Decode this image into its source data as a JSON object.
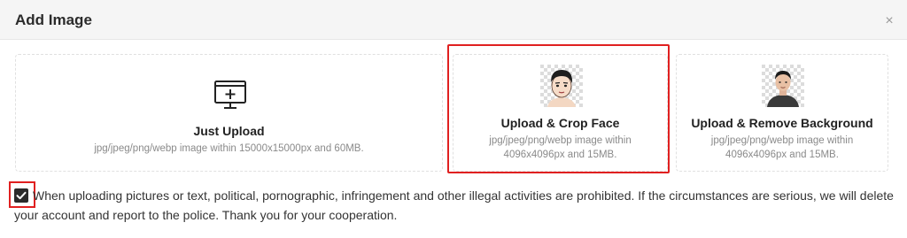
{
  "dialog": {
    "title": "Add Image",
    "close_icon": "close-icon",
    "close_glyph": "×"
  },
  "options": [
    {
      "title": "Just Upload",
      "description": "jpg/jpeg/png/webp image within 15000x15000px and 60MB.",
      "icon": "monitor-plus-icon"
    },
    {
      "title": "Upload & Crop Face",
      "description": "jpg/jpeg/png/webp image within 4096x4096px and 15MB.",
      "icon": "face-portrait-icon",
      "highlighted": true
    },
    {
      "title": "Upload & Remove Background",
      "description": "jpg/jpeg/png/webp image within 4096x4096px and 15MB.",
      "icon": "portrait-transparent-bg-icon"
    }
  ],
  "agreement": {
    "checked": true,
    "text": "When uploading pictures or text, political, pornographic, infringement and other illegal activities are prohibited. If the circumstances are serious, we will delete your account and report to the police. Thank you for your cooperation."
  },
  "colors": {
    "highlight": "#e02020",
    "header_bg": "#f5f5f5",
    "checkbox": "#2a2a2a"
  }
}
